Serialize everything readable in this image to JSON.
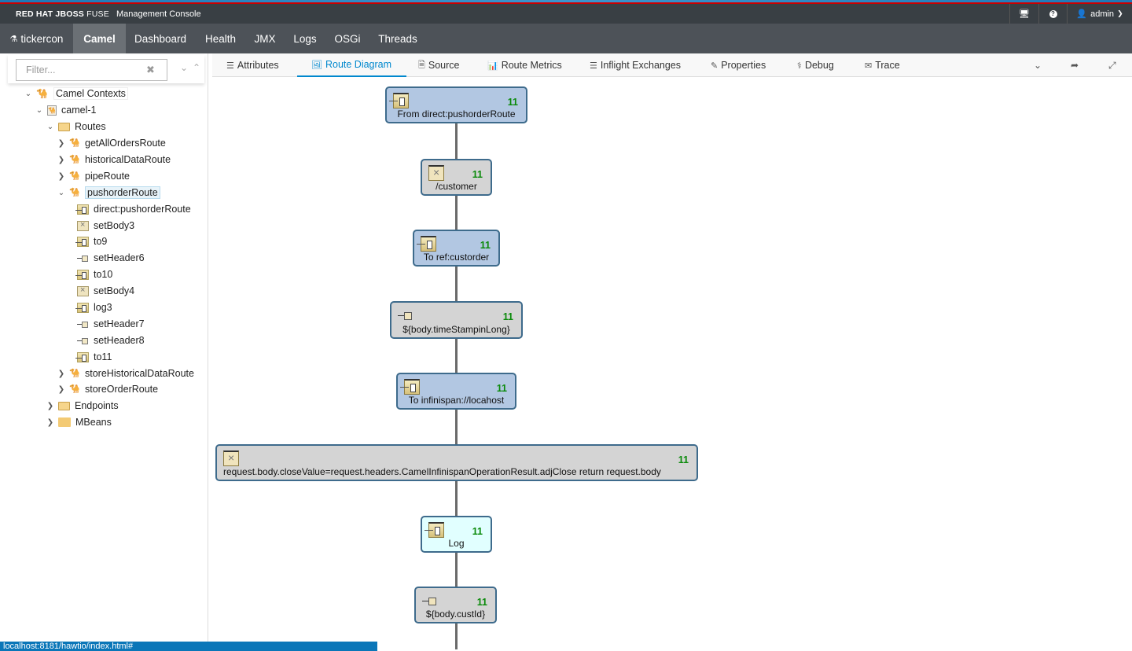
{
  "header": {
    "brand": "RED HAT JBOSS",
    "brand_product": "FUSE",
    "brand_subtitle": "Management Console",
    "user": "admin"
  },
  "nav": {
    "container": "tickercon",
    "items": [
      {
        "label": "Camel",
        "active": true
      },
      {
        "label": "Dashboard"
      },
      {
        "label": "Health"
      },
      {
        "label": "JMX"
      },
      {
        "label": "Logs"
      },
      {
        "label": "OSGi"
      },
      {
        "label": "Threads"
      }
    ]
  },
  "sidebar": {
    "filter_placeholder": "Filter...",
    "tree": [
      {
        "label": "Camel Contexts",
        "icon": "camel-icon",
        "expanded": true
      },
      {
        "label": "camel-1",
        "icon": "camel-context-icon",
        "expanded": true
      },
      {
        "label": "Routes",
        "icon": "folder-open-icon",
        "expanded": true
      },
      {
        "label": "getAllOrdersRoute",
        "icon": "route-icon",
        "expanded": false
      },
      {
        "label": "historicalDataRoute",
        "icon": "route-icon",
        "expanded": false
      },
      {
        "label": "pipeRoute",
        "icon": "route-icon",
        "expanded": false
      },
      {
        "label": "pushorderRoute",
        "icon": "route-icon",
        "expanded": true,
        "selected": true
      },
      {
        "label": "direct:pushorderRoute",
        "icon": "endpoint-icon"
      },
      {
        "label": "setBody3",
        "icon": "set-body-icon"
      },
      {
        "label": "to9",
        "icon": "endpoint-icon"
      },
      {
        "label": "setHeader6",
        "icon": "set-header-icon"
      },
      {
        "label": "to10",
        "icon": "endpoint-icon"
      },
      {
        "label": "setBody4",
        "icon": "set-body-icon"
      },
      {
        "label": "log3",
        "icon": "endpoint-icon"
      },
      {
        "label": "setHeader7",
        "icon": "set-header-icon"
      },
      {
        "label": "setHeader8",
        "icon": "set-header-icon"
      },
      {
        "label": "to11",
        "icon": "endpoint-icon"
      },
      {
        "label": "storeHistoricalDataRoute",
        "icon": "route-icon",
        "expanded": false
      },
      {
        "label": "storeOrderRoute",
        "icon": "route-icon",
        "expanded": false
      },
      {
        "label": "Endpoints",
        "icon": "folder-open-icon",
        "expanded": false
      },
      {
        "label": "MBeans",
        "icon": "folder-icon",
        "expanded": false
      }
    ]
  },
  "tabs": [
    {
      "label": "Attributes",
      "icon": "list-icon"
    },
    {
      "label": "Route Diagram",
      "icon": "image-icon",
      "active": true
    },
    {
      "label": "Source",
      "icon": "file-icon"
    },
    {
      "label": "Route Metrics",
      "icon": "bar-chart-icon"
    },
    {
      "label": "Inflight Exchanges",
      "icon": "list-icon"
    },
    {
      "label": "Properties",
      "icon": "edit-icon"
    },
    {
      "label": "Debug",
      "icon": "stethoscope-icon"
    },
    {
      "label": "Trace",
      "icon": "envelope-icon"
    }
  ],
  "diagram": {
    "nodes": [
      {
        "label": "From direct:pushorderRoute",
        "count": "11",
        "kind": "endpoint",
        "color": "#b2c7e2"
      },
      {
        "label": "/customer",
        "count": "11",
        "kind": "set-body",
        "color": "#d4d4d4"
      },
      {
        "label": "To ref:custorder",
        "count": "11",
        "kind": "endpoint",
        "color": "#b2c7e2"
      },
      {
        "label": "${body.timeStampinLong}",
        "count": "11",
        "kind": "set-header",
        "color": "#d4d4d4"
      },
      {
        "label": "To infinispan://locahost",
        "count": "11",
        "kind": "endpoint",
        "color": "#b2c7e2"
      },
      {
        "label": "request.body.closeValue=request.headers.CamelInfinispanOperationResult.adjClose return request.body",
        "count": "11",
        "kind": "set-body",
        "color": "#d4d4d4"
      },
      {
        "label": "Log",
        "count": "11",
        "kind": "log",
        "color": "#e1ffff"
      },
      {
        "label": "${body.custId}",
        "count": "11",
        "kind": "set-header",
        "color": "#d4d4d4"
      }
    ]
  },
  "statusbar": {
    "url": "localhost:8181/hawtio/index.html#"
  }
}
